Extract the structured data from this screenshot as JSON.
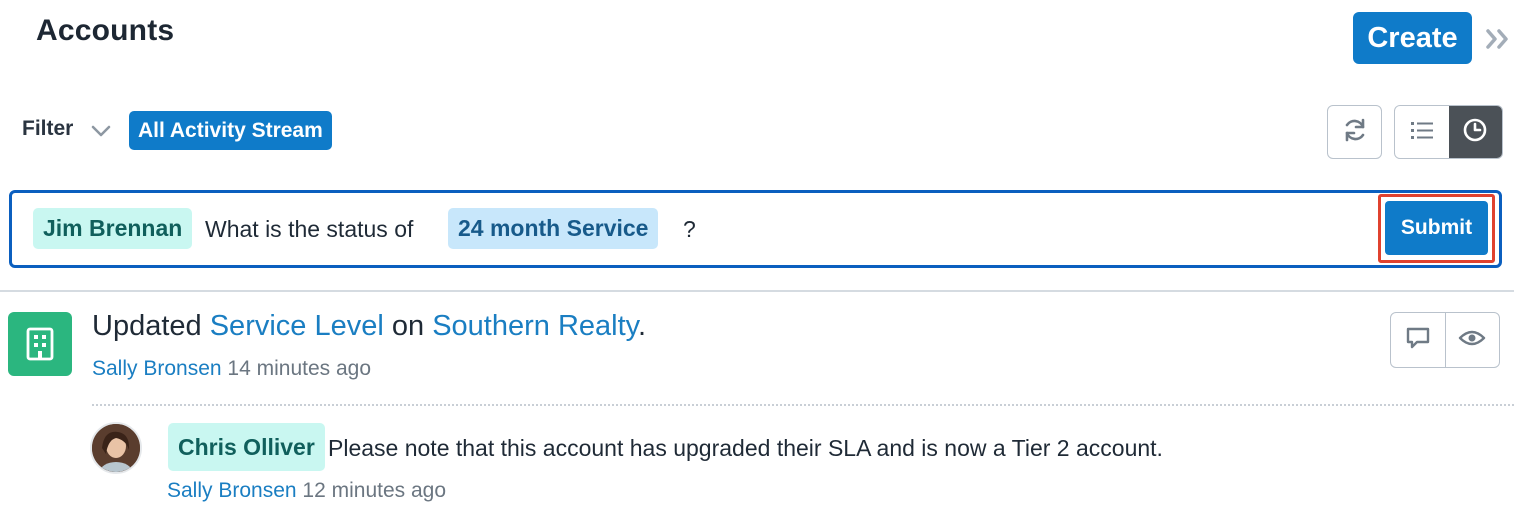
{
  "header": {
    "title": "Accounts",
    "create_label": "Create",
    "expand_icon": "double-chevron-right-icon"
  },
  "filter": {
    "label": "Filter",
    "chevron_icon": "chevron-down-icon",
    "active": "All Activity Stream"
  },
  "toolbar": {
    "refresh_icon": "refresh-icon",
    "list_view_icon": "list-icon",
    "activity_view_icon": "clock-icon",
    "active_view": "activity"
  },
  "composer": {
    "mention": "Jim Brennan",
    "text_before": "What is the status of",
    "record_tag": "24 month Service",
    "text_after": "?",
    "submit_label": "Submit"
  },
  "activity": {
    "module_icon": "building-icon",
    "action": "Updated",
    "field": "Service Level",
    "connector": "on",
    "record": "Southern Realty",
    "punctuation": ".",
    "author": "Sally Bronsen",
    "time": "14 minutes ago",
    "comment_icon": "comment-icon",
    "preview_icon": "eye-icon"
  },
  "comment": {
    "avatar": "avatar",
    "mention": "Chris Olliver",
    "text": "Please note that this account has upgraded their SLA and is now a Tier 2 account.",
    "author": "Sally Bronsen",
    "time": "12 minutes ago"
  },
  "colors": {
    "primary": "#0f7bc9",
    "module_green": "#2bb67f",
    "focus_border": "#0b5fbf",
    "highlight_red": "#e0422f"
  }
}
